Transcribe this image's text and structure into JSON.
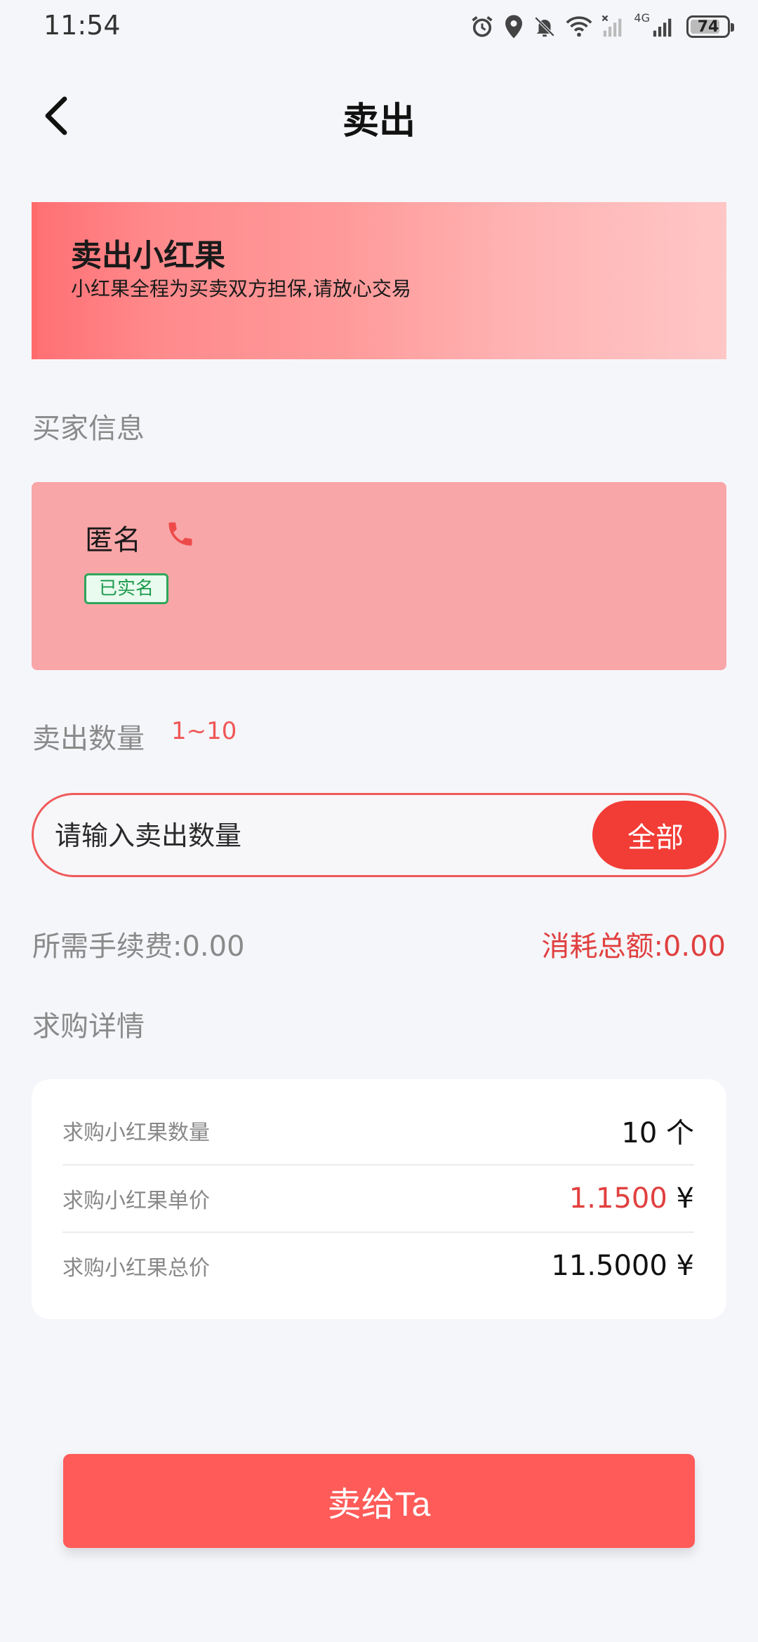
{
  "status_bar": {
    "time": "11:54",
    "battery": "74",
    "network": "4G"
  },
  "nav": {
    "title": "卖出"
  },
  "banner": {
    "title": "卖出小红果",
    "subtitle": "小红果全程为买卖双方担保,请放心交易"
  },
  "buyer_section": {
    "label": "买家信息"
  },
  "buyer": {
    "name": "匿名",
    "verified_label": "已实名"
  },
  "quantity_section": {
    "label": "卖出数量",
    "range": "1~10"
  },
  "quantity_input": {
    "placeholder": "请输入卖出数量",
    "value": "",
    "all_label": "全部"
  },
  "fees": {
    "fee": "所需手续费:0.00",
    "total": "消耗总额:0.00"
  },
  "details_section": {
    "label": "求购详情"
  },
  "details": {
    "rows": [
      {
        "label": "求购小红果数量",
        "value": "10 个"
      },
      {
        "label": "求购小红果单价",
        "value": "1.1500",
        "unit": " ¥"
      },
      {
        "label": "求购小红果总价",
        "value": "11.5000 ¥"
      }
    ]
  },
  "sell_button": {
    "label": "卖给Ta"
  },
  "colors": {
    "accent": "#f23c36",
    "primary_button": "#ff5b59",
    "verified": "#2fa65a",
    "buyer_card": "#f9a6a8"
  }
}
